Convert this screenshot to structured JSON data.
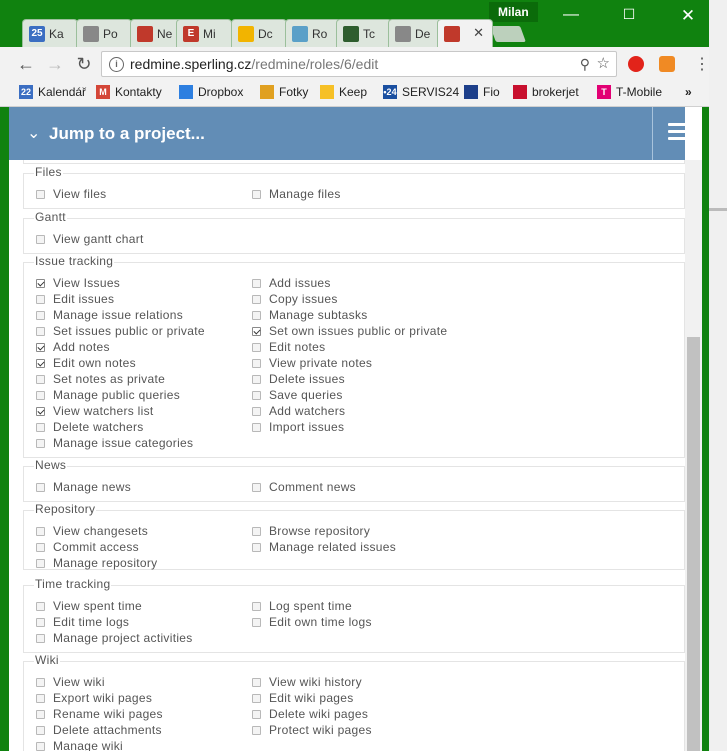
{
  "browser": {
    "profile_name": "Milan",
    "tabs": [
      {
        "title": "Ka",
        "icon": "calendar-icon",
        "icon_text": "25",
        "icon_color": "#3b6ec2"
      },
      {
        "title": "Po",
        "icon": "document-icon",
        "icon_text": "",
        "icon_color": "#888888"
      },
      {
        "title": "Ne",
        "icon": "redmine-icon",
        "icon_text": "",
        "icon_color": "#c0392b"
      },
      {
        "title": "Mi",
        "icon": "e-icon",
        "icon_text": "E",
        "icon_color": "#c0392b"
      },
      {
        "title": "Dc",
        "icon": "drive-icon",
        "icon_text": "",
        "icon_color": "#f2b400"
      },
      {
        "title": "Ro",
        "icon": "gear-icon",
        "icon_text": "",
        "icon_color": "#5aa0c8"
      },
      {
        "title": "Tc",
        "icon": "bolt-icon",
        "icon_text": "",
        "icon_color": "#2e5d2e"
      },
      {
        "title": "De",
        "icon": "document-icon",
        "icon_text": "",
        "icon_color": "#888888"
      },
      {
        "title": "",
        "icon": "redmine-icon",
        "icon_text": "",
        "icon_color": "#c0392b"
      }
    ],
    "url_host": "redmine.sperling.cz",
    "url_path": "/redmine/roles/6/edit",
    "bookmarks": [
      {
        "label": "Kalendář",
        "icon": "calendar-icon",
        "icon_text": "22",
        "color": "#3b6ec2"
      },
      {
        "label": "Kontakty",
        "icon": "gmail-icon",
        "icon_text": "M",
        "color": "#d44638"
      },
      {
        "label": "Dropbox",
        "icon": "dropbox-icon",
        "icon_text": "",
        "color": "#2d7fe0"
      },
      {
        "label": "Fotky",
        "icon": "photos-icon",
        "icon_text": "",
        "color": "#e0a020"
      },
      {
        "label": "Keep",
        "icon": "keep-icon",
        "icon_text": "",
        "color": "#f6c026"
      },
      {
        "label": "SERVIS24",
        "icon": "servis24-icon",
        "icon_text": "•24",
        "color": "#1a4fa0"
      },
      {
        "label": "Fio",
        "icon": "fio-icon",
        "icon_text": "",
        "color": "#1d3f8a"
      },
      {
        "label": "brokerjet",
        "icon": "brokerjet-icon",
        "icon_text": "",
        "color": "#c8102e"
      },
      {
        "label": "T-Mobile",
        "icon": "tmobile-icon",
        "icon_text": "T",
        "color": "#e20074"
      }
    ],
    "more_bookmarks": "»"
  },
  "jump": {
    "label": "Jump to a project..."
  },
  "groups": [
    {
      "title": "Files",
      "perms": [
        {
          "label": "View files",
          "checked": false
        },
        {
          "label": "Manage files",
          "checked": false
        }
      ]
    },
    {
      "title": "Gantt",
      "perms": [
        {
          "label": "View gantt chart",
          "checked": false
        }
      ]
    },
    {
      "title": "Issue tracking",
      "perms": [
        {
          "label": "View Issues",
          "checked": true
        },
        {
          "label": "Add issues",
          "checked": false
        },
        {
          "label": "Edit issues",
          "checked": false
        },
        {
          "label": "Copy issues",
          "checked": false
        },
        {
          "label": "Manage issue relations",
          "checked": false
        },
        {
          "label": "Manage subtasks",
          "checked": false
        },
        {
          "label": "Set issues public or private",
          "checked": false
        },
        {
          "label": "Set own issues public or private",
          "checked": true
        },
        {
          "label": "Add notes",
          "checked": true
        },
        {
          "label": "Edit notes",
          "checked": false
        },
        {
          "label": "Edit own notes",
          "checked": true
        },
        {
          "label": "View private notes",
          "checked": false
        },
        {
          "label": "Set notes as private",
          "checked": false
        },
        {
          "label": "Delete issues",
          "checked": false
        },
        {
          "label": "Manage public queries",
          "checked": false
        },
        {
          "label": "Save queries",
          "checked": false
        },
        {
          "label": "View watchers list",
          "checked": true
        },
        {
          "label": "Add watchers",
          "checked": false
        },
        {
          "label": "Delete watchers",
          "checked": false
        },
        {
          "label": "Import issues",
          "checked": false
        },
        {
          "label": "Manage issue categories",
          "checked": false
        }
      ]
    },
    {
      "title": "News",
      "perms": [
        {
          "label": "Manage news",
          "checked": false
        },
        {
          "label": "Comment news",
          "checked": false
        }
      ]
    },
    {
      "title": "Repository",
      "perms": [
        {
          "label": "View changesets",
          "checked": false
        },
        {
          "label": "Browse repository",
          "checked": false
        },
        {
          "label": "Commit access",
          "checked": false
        },
        {
          "label": "Manage related issues",
          "checked": false
        },
        {
          "label": "Manage repository",
          "checked": false
        }
      ]
    },
    {
      "title": "Time tracking",
      "perms": [
        {
          "label": "View spent time",
          "checked": false
        },
        {
          "label": "Log spent time",
          "checked": false
        },
        {
          "label": "Edit time logs",
          "checked": false
        },
        {
          "label": "Edit own time logs",
          "checked": false
        },
        {
          "label": "Manage project activities",
          "checked": false
        }
      ]
    },
    {
      "title": "Wiki",
      "perms": [
        {
          "label": "View wiki",
          "checked": false
        },
        {
          "label": "View wiki history",
          "checked": false
        },
        {
          "label": "Export wiki pages",
          "checked": false
        },
        {
          "label": "Edit wiki pages",
          "checked": false
        },
        {
          "label": "Rename wiki pages",
          "checked": false
        },
        {
          "label": "Delete wiki pages",
          "checked": false
        },
        {
          "label": "Delete attachments",
          "checked": false
        },
        {
          "label": "Protect wiki pages",
          "checked": false
        },
        {
          "label": "Manage wiki",
          "checked": false
        }
      ]
    }
  ]
}
